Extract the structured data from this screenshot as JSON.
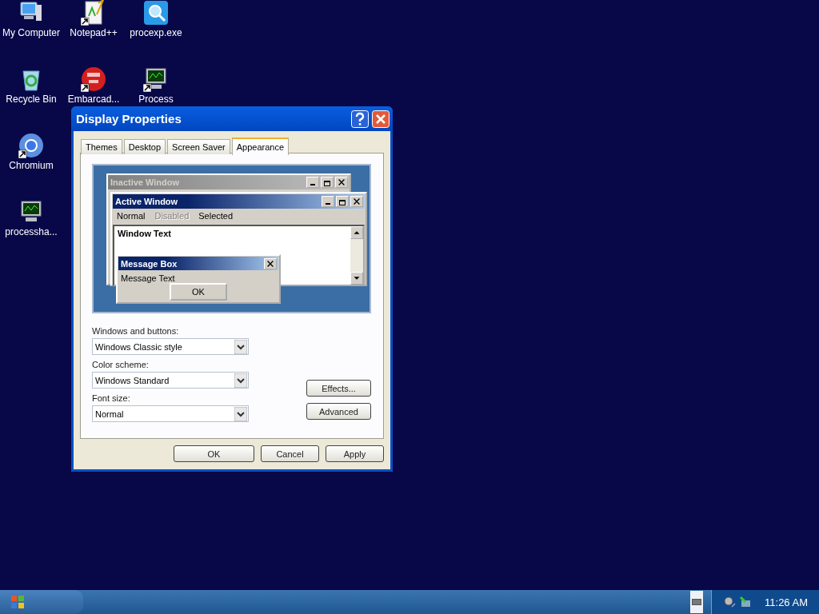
{
  "desktop_icons": [
    {
      "label": "My Computer",
      "kind": "computer"
    },
    {
      "label": "Notepad++",
      "kind": "notepad",
      "shortcut": true
    },
    {
      "label": "procexp.exe",
      "kind": "magnifier",
      "shortcut": false
    },
    {
      "label": "Recycle Bin",
      "kind": "recycle"
    },
    {
      "label": "Embarcad...",
      "kind": "dev",
      "shortcut": true
    },
    {
      "label": "Process",
      "kind": "monitor",
      "shortcut": true
    },
    {
      "label": "Chromium",
      "kind": "chromium",
      "shortcut": true
    },
    {
      "label": "processha...",
      "kind": "monitor",
      "shortcut": false
    }
  ],
  "dialog": {
    "title": "Display Properties",
    "tabs": [
      {
        "label": "Themes",
        "selected": false
      },
      {
        "label": "Desktop",
        "selected": false
      },
      {
        "label": "Screen Saver",
        "selected": false
      },
      {
        "label": "Appearance",
        "selected": true
      }
    ],
    "preview": {
      "inactive_title": "Inactive Window",
      "active_title": "Active Window",
      "menu": [
        {
          "label": "Normal",
          "kind": "normal"
        },
        {
          "label": "Disabled",
          "kind": "disabled"
        },
        {
          "label": "Selected",
          "kind": "selected"
        }
      ],
      "window_text": "Window Text",
      "message_title": "Message Box",
      "message_text": "Message Text",
      "ok": "OK"
    },
    "fields": [
      {
        "label": "Windows and buttons:",
        "value": "Windows Classic style"
      },
      {
        "label": "Color scheme:",
        "value": "Windows Standard"
      },
      {
        "label": "Font size:",
        "value": "Normal"
      }
    ],
    "side_buttons": [
      "Effects...",
      "Advanced"
    ],
    "buttons": [
      "OK",
      "Cancel",
      "Apply"
    ]
  },
  "taskbar": {
    "clock": "11:26 AM"
  }
}
